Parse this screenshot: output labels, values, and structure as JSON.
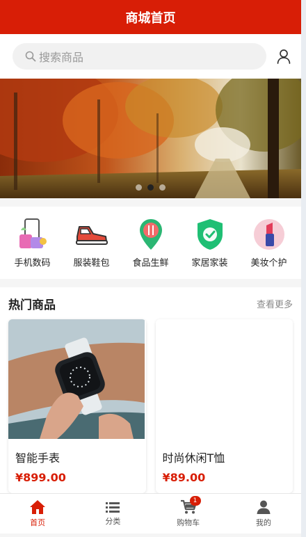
{
  "header": {
    "title": "商城首页"
  },
  "search": {
    "placeholder": "搜索商品"
  },
  "banner": {
    "slide_count": 3,
    "active_index": 1
  },
  "categories": [
    {
      "label": "手机数码",
      "icon": "phone-digital-icon"
    },
    {
      "label": "服装鞋包",
      "icon": "sneaker-icon"
    },
    {
      "label": "食品生鲜",
      "icon": "food-pin-icon"
    },
    {
      "label": "家居家装",
      "icon": "shield-check-icon"
    },
    {
      "label": "美妆个护",
      "icon": "lipstick-icon"
    }
  ],
  "hot": {
    "title": "热门商品",
    "more": "查看更多",
    "products": [
      {
        "name": "智能手表",
        "price": "¥899.00"
      },
      {
        "name": "时尚休闲T恤",
        "price": "¥89.00"
      }
    ]
  },
  "tabbar": {
    "items": [
      {
        "label": "首页",
        "icon": "home-icon",
        "active": true
      },
      {
        "label": "分类",
        "icon": "list-icon",
        "active": false
      },
      {
        "label": "购物车",
        "icon": "cart-icon",
        "active": false,
        "badge": "1"
      },
      {
        "label": "我的",
        "icon": "profile-icon",
        "active": false
      }
    ]
  },
  "colors": {
    "primary": "#d81e06",
    "background": "#f5f5f5",
    "text": "#222222"
  }
}
